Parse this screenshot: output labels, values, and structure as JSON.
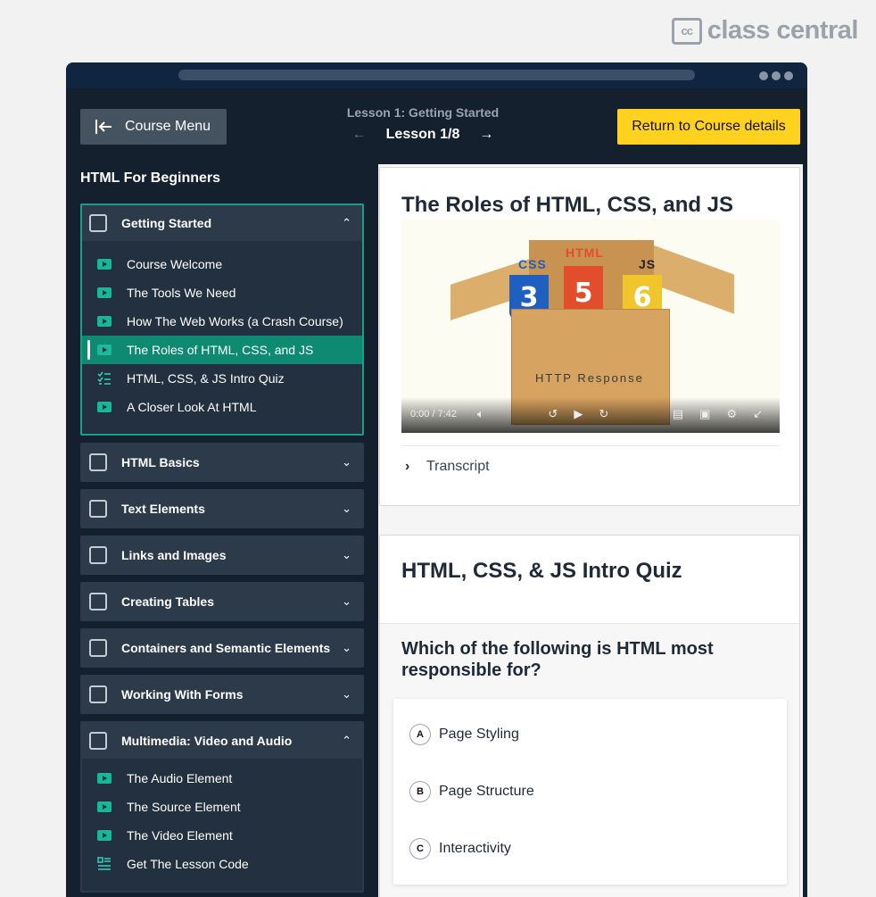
{
  "brand": {
    "mark": "cc",
    "name": "class central"
  },
  "header": {
    "course_menu_label": "Course Menu",
    "lesson_section": "Lesson 1: Getting Started",
    "lesson_counter": "Lesson 1/8",
    "prev_arrow": "←",
    "next_arrow": "→",
    "return_label": "Return to Course details"
  },
  "course": {
    "title": "HTML For Beginners"
  },
  "sidebar": {
    "sections": [
      {
        "title": "Getting Started",
        "expanded": true,
        "items": [
          {
            "label": "Course Welcome",
            "icon": "video-icon"
          },
          {
            "label": "The Tools We Need",
            "icon": "video-icon"
          },
          {
            "label": "How The Web Works (a Crash Course)",
            "icon": "video-icon"
          },
          {
            "label": "The Roles of HTML, CSS, and JS",
            "icon": "video-icon",
            "current": true
          },
          {
            "label": "HTML, CSS, & JS Intro Quiz",
            "icon": "quiz-icon"
          },
          {
            "label": "A Closer Look At HTML",
            "icon": "video-icon"
          }
        ]
      },
      {
        "title": "HTML Basics",
        "expanded": false
      },
      {
        "title": "Text Elements",
        "expanded": false
      },
      {
        "title": "Links and Images",
        "expanded": false
      },
      {
        "title": "Creating Tables",
        "expanded": false
      },
      {
        "title": "Containers and Semantic Elements",
        "expanded": false
      },
      {
        "title": "Working With Forms",
        "expanded": false
      },
      {
        "title": "Multimedia: Video and Audio",
        "expanded": true,
        "items": [
          {
            "label": "The Audio Element",
            "icon": "video-icon"
          },
          {
            "label": "The Source Element",
            "icon": "video-icon"
          },
          {
            "label": "The Video Element",
            "icon": "video-icon"
          },
          {
            "label": "Get The Lesson Code",
            "icon": "text-lesson-icon"
          }
        ]
      }
    ]
  },
  "lesson": {
    "title": "The Roles of HTML, CSS, and JS",
    "video": {
      "labels": {
        "css": "CSS",
        "html": "HTML",
        "js": "JS",
        "css_num": "3",
        "html_num": "5",
        "js_num": "6"
      },
      "box_text": "HTTP Response",
      "time": "0:00 / 7:42"
    },
    "transcript_label": "Transcript"
  },
  "quiz": {
    "title": "HTML, CSS, & JS Intro Quiz",
    "question": "Which of the following is HTML most responsible for?",
    "answers": [
      {
        "letter": "A",
        "text": "Page Styling"
      },
      {
        "letter": "B",
        "text": "Page Structure"
      },
      {
        "letter": "C",
        "text": "Interactivity"
      }
    ]
  },
  "colors": {
    "accent": "#16a085",
    "return_button": "#ffd21f",
    "window_bg": "#15202e"
  }
}
